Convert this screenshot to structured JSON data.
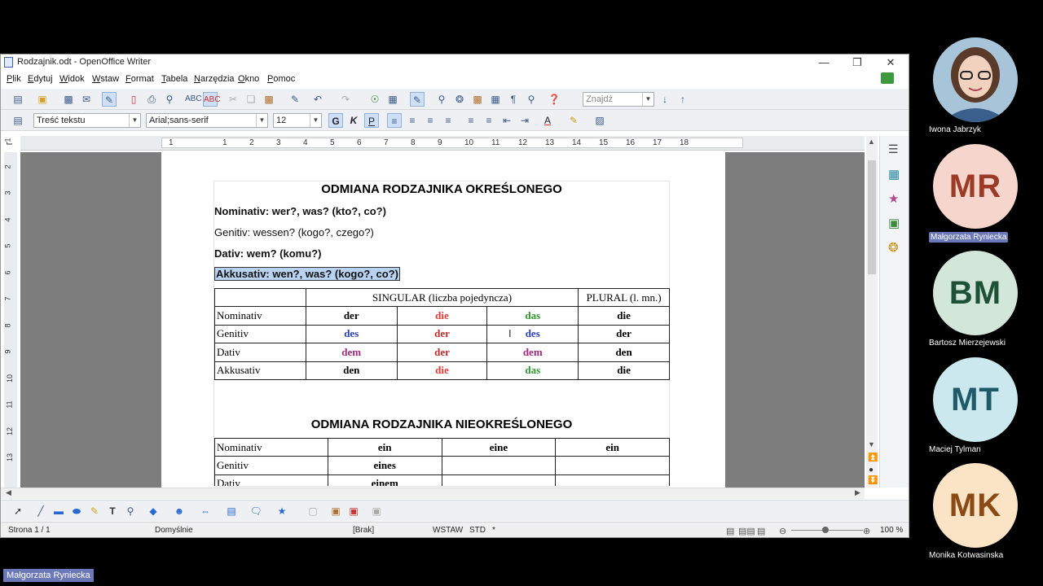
{
  "window": {
    "title": "Rodzajnik.odt - OpenOffice Writer"
  },
  "menu": [
    "Plik",
    "Edytuj",
    "Widok",
    "Wstaw",
    "Format",
    "Tabela",
    "Narzędzia",
    "Okno",
    "Pomoc"
  ],
  "toolbar": {
    "find_placeholder": "Znajdź",
    "paragraph_style": "Treść tekstu",
    "font_name": "Arial;sans-serif",
    "font_size": "12",
    "bold_label": "G",
    "italic_label": "K",
    "underline_label": "P"
  },
  "ruler": {
    "numbers": [
      "1",
      "1",
      "2",
      "3",
      "4",
      "5",
      "6",
      "7",
      "8",
      "9",
      "10",
      "11",
      "12",
      "13",
      "14",
      "15",
      "16",
      "17",
      "18"
    ]
  },
  "vruler": {
    "numbers": [
      "1",
      "2",
      "3",
      "4",
      "5",
      "6",
      "7",
      "8",
      "9",
      "10",
      "11",
      "12",
      "13"
    ]
  },
  "document": {
    "title1": "ODMIANA RODZAJNIKA OKREŚLONEGO",
    "lines": [
      {
        "text": "Nominativ: wer?, was? (kto?, co?)",
        "bold": true
      },
      {
        "text": "Genitiv: wessen? (kogo?, czego?)",
        "bold": false
      },
      {
        "text": "Dativ: wem? (komu?)",
        "bold": true
      },
      {
        "text": "Akkusativ: wen?, was? (kogo?, co?)",
        "bold": true,
        "selected": true
      }
    ],
    "table1": {
      "header_singular": "SINGULAR (liczba pojedyncza)",
      "header_plural": "PLURAL (l. mn.)",
      "rows": [
        {
          "case": "Nominativ",
          "cells": [
            {
              "t": "der",
              "c": "#000000"
            },
            {
              "t": "die",
              "c": "#e53935"
            },
            {
              "t": "das",
              "c": "#2e9a2e"
            },
            {
              "t": "die",
              "c": "#000000"
            }
          ]
        },
        {
          "case": "Genitiv",
          "cells": [
            {
              "t": "des",
              "c": "#2a3fb8"
            },
            {
              "t": "der",
              "c": "#c62828"
            },
            {
              "t": "des",
              "c": "#2a3fb8"
            },
            {
              "t": "der",
              "c": "#000000"
            }
          ]
        },
        {
          "case": "Dativ",
          "cells": [
            {
              "t": "dem",
              "c": "#a0287a"
            },
            {
              "t": "der",
              "c": "#c62828"
            },
            {
              "t": "dem",
              "c": "#a0287a"
            },
            {
              "t": "den",
              "c": "#000000"
            }
          ]
        },
        {
          "case": "Akkusativ",
          "cells": [
            {
              "t": "den",
              "c": "#000000"
            },
            {
              "t": "die",
              "c": "#e53935"
            },
            {
              "t": "das",
              "c": "#2e9a2e"
            },
            {
              "t": "die",
              "c": "#000000"
            }
          ]
        }
      ]
    },
    "title2": "ODMIANA RODZAJNIKA NIEOKREŚLONEGO",
    "table2": {
      "rows": [
        {
          "case": "Nominativ",
          "cells": [
            "ein",
            "eine",
            "ein"
          ]
        },
        {
          "case": "Genitiv",
          "cells": [
            "eines",
            "",
            ""
          ]
        },
        {
          "case": "Dativ",
          "cells": [
            "einem",
            "",
            ""
          ]
        }
      ]
    }
  },
  "status": {
    "page": "Strona 1 / 1",
    "page_style": "Domyślnie",
    "language": "[Brak]",
    "insert_mode": "WSTAW",
    "selection_mode": "STD",
    "modified": "*",
    "zoom": "100 %"
  },
  "participants": [
    {
      "name": "Iwona Jabrzyk",
      "initials": "",
      "photo": true
    },
    {
      "name": "Małgorzata Ryniecka",
      "initials": "MR",
      "bg": "#f6d6cc",
      "fg": "#9b3a26",
      "highlight": true
    },
    {
      "name": "Bartosz Mierzejewski",
      "initials": "BM",
      "bg": "#d2e6da",
      "fg": "#1e5236"
    },
    {
      "name": "Maciej Tylman",
      "initials": "MT",
      "bg": "#cce8ef",
      "fg": "#1f5a68"
    },
    {
      "name": "Monika Kotwasinska",
      "initials": "MK",
      "bg": "#fbe3c6",
      "fg": "#8b4a15"
    }
  ],
  "presenter_label": "Małgorzata Ryniecka"
}
